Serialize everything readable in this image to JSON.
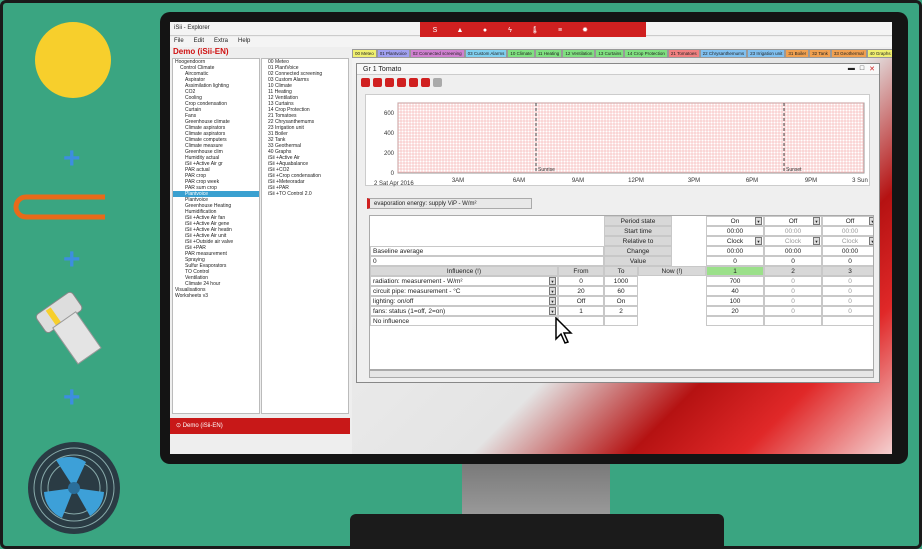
{
  "app": {
    "title": "iSii - Explorer",
    "menu": [
      "File",
      "Edit",
      "Extra",
      "Help"
    ],
    "side_title": "Demo (iSii-EN)",
    "status_label": "Demo (iSii-EN)"
  },
  "toolbar_icons": [
    "logo",
    "warning-icon",
    "drop-icon",
    "lightning-icon",
    "thermometer-icon",
    "list-icon",
    "settings-icon"
  ],
  "tree_left": [
    "Hoogendoorn",
    "Control Climate",
    "Aircomatic",
    "Aspirator",
    "Assimilation lighting",
    "CO2",
    "Cooling",
    "Crop condensation",
    "Curtain",
    "Fans",
    "Greenhouse climate",
    "Climate aspirators",
    "Climate aspirators",
    "Climate computers",
    "Climate measure",
    "Greenhouse clim",
    "Humidity actual",
    "iSii +Active Air gr",
    "PAR actual",
    "PAR crop",
    "PAR crop week",
    "PAR sum crop",
    "Plantvoice",
    "Plantvoice",
    "Greenhouse Heating",
    "Humidification",
    "iSii +Active Air fan",
    "iSii +Active Air gene",
    "iSii +Active Air heatin",
    "iSii +Active Air unit",
    "iSii +Outside air valve",
    "iSii +PAR",
    "PAR measurement",
    "Spraying",
    "Sulfur Evaporators",
    "TO Control",
    "Ventilation",
    "Climate 24 hour",
    "Visualisations",
    "Worksheets v3"
  ],
  "tree_right": [
    "00 Meteo",
    "01 PlantVoice",
    "02 Connected screening",
    "03 Custom Alarms",
    "10 Climate",
    "11 Heating",
    "12 Ventilation",
    "13 Curtains",
    "14 Crop Protection",
    "21 Tomatoes",
    "22 Chrysanthemums",
    "23 Irrigation unit",
    "31 Boiler",
    "32 Tank",
    "33 Geothermal",
    "40 Graphs",
    "iSii +Active Air",
    "iSii +Aquabalance",
    "iSii +CO2",
    "iSii +Crop condensation",
    "iSii +Meteoradar",
    "iSii +PAR",
    "iSii +TO Control 2.0"
  ],
  "tabs": [
    "00 Meteo",
    "01 Plantvoice",
    "02 Connected screening",
    "03 Custom Alarms",
    "10 Climate",
    "11 Heating",
    "12 Ventilation",
    "13 Curtains",
    "14 Crop Protection",
    "21 Tomatoes",
    "22 Chrysanthemums",
    "23 Irrigation unit",
    "31 Boiler",
    "32 Tank",
    "33 Geothermal",
    "40 Graphs"
  ],
  "tab_colors": [
    "#f0f070",
    "#a0a0f0",
    "#d080d0",
    "#80d0f0",
    "#80e080",
    "#80e080",
    "#80e080",
    "#80e080",
    "#80e080",
    "#f08080",
    "#80c0f0",
    "#80c0f0",
    "#f0a050",
    "#f0a050",
    "#f0a050",
    "#f0f070"
  ],
  "window": {
    "title": "Gr 1 Tomato"
  },
  "chart_data": {
    "type": "line",
    "y_ticks": [
      "600",
      "400",
      "200",
      "0"
    ],
    "ylim": [
      0,
      700
    ],
    "x_ticks": [
      "3AM",
      "6AM",
      "9AM",
      "12PM",
      "3PM",
      "6PM",
      "9PM",
      "3 Sun"
    ],
    "date_label": "2 Sat Apr 2016",
    "markers": [
      "Sunrise",
      "Sunset"
    ],
    "grid": true
  },
  "evaporation_button": "evaporation energy: supply ViP - W/m²",
  "table": {
    "period_rows": [
      {
        "label": "Period state",
        "values": [
          "On",
          "Off",
          "Off"
        ]
      },
      {
        "label": "Start time",
        "values": [
          "00:00",
          "00:00",
          "00:00"
        ]
      },
      {
        "label": "Relative to",
        "values": [
          "Clock",
          "Clock",
          "Clock"
        ]
      },
      {
        "label": "Change",
        "values": [
          "00:00",
          "00:00",
          "00:00"
        ]
      },
      {
        "label": "Value",
        "values": [
          "0",
          "0",
          "0"
        ]
      }
    ],
    "baseline_label": "Baseline average",
    "baseline_value": "0",
    "influence_header": "Influence (!)",
    "from_header": "From",
    "to_header": "To",
    "now_header": "Now (!)",
    "period_numbers": [
      "1",
      "2",
      "3"
    ],
    "influences": [
      {
        "name": "radiation: measurement - W/m²",
        "from": "0",
        "to": "1000",
        "p1": "700",
        "p2": "0",
        "p3": "0"
      },
      {
        "name": "circuit pipe: measurement - °C",
        "from": "20",
        "to": "60",
        "p1": "40",
        "p2": "0",
        "p3": "0"
      },
      {
        "name": "lighting: on/off",
        "from": "Off",
        "to": "On",
        "p1": "100",
        "p2": "0",
        "p3": "0"
      },
      {
        "name": "fans: status (1=off, 2=on)",
        "from": "1",
        "to": "2",
        "p1": "20",
        "p2": "0",
        "p3": "0"
      },
      {
        "name": "No influence",
        "from": "",
        "to": "",
        "p1": "",
        "p2": "",
        "p3": ""
      }
    ]
  },
  "colors": {
    "sun": "#f7cf2c",
    "accent": "#d02020",
    "background": "#3aa581",
    "plus": "#3d8ee0"
  }
}
